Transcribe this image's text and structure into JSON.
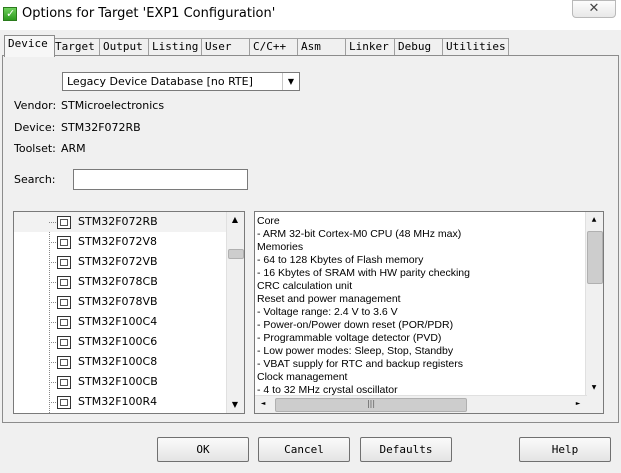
{
  "window": {
    "title": "Options for Target 'EXP1 Configuration'",
    "close_glyph": "✕"
  },
  "tabs": [
    {
      "label": "Device"
    },
    {
      "label": "Target"
    },
    {
      "label": "Output"
    },
    {
      "label": "Listing"
    },
    {
      "label": "User"
    },
    {
      "label": "C/C++"
    },
    {
      "label": "Asm"
    },
    {
      "label": "Linker"
    },
    {
      "label": "Debug"
    },
    {
      "label": "Utilities"
    }
  ],
  "database_select": {
    "value": "Legacy Device Database [no RTE]"
  },
  "info": {
    "vendor_label": "Vendor:",
    "vendor_value": "STMicroelectronics",
    "device_label": "Device:",
    "device_value": "STM32F072RB",
    "toolset_label": "Toolset:",
    "toolset_value": "ARM",
    "search_label": "Search:"
  },
  "device_list": [
    "STM32F072RB",
    "STM32F072V8",
    "STM32F072VB",
    "STM32F078CB",
    "STM32F078VB",
    "STM32F100C4",
    "STM32F100C6",
    "STM32F100C8",
    "STM32F100CB",
    "STM32F100R4"
  ],
  "description": [
    "Core",
    " - ARM 32-bit Cortex-M0 CPU (48 MHz max)",
    "Memories",
    " - 64 to 128 Kbytes of Flash memory",
    " - 16 Kbytes of SRAM with HW parity checking",
    "CRC calculation unit",
    "Reset and power management",
    " - Voltage range: 2.4 V to 3.6 V",
    " - Power-on/Power down reset (POR/PDR)",
    " - Programmable voltage detector (PVD)",
    " - Low power modes: Sleep, Stop, Standby",
    " - VBAT supply for RTC and backup registers",
    "Clock management",
    " - 4 to 32 MHz crystal oscillator"
  ],
  "buttons": {
    "ok": "OK",
    "cancel": "Cancel",
    "defaults": "Defaults",
    "help": "Help"
  },
  "scroll_glyphs": {
    "up": "▲",
    "down": "▼",
    "left": "◄",
    "right": "►",
    "grip": "|||"
  },
  "colors": {
    "dialog_bg": "#f0f0f0",
    "border": "#7a7a7a"
  }
}
